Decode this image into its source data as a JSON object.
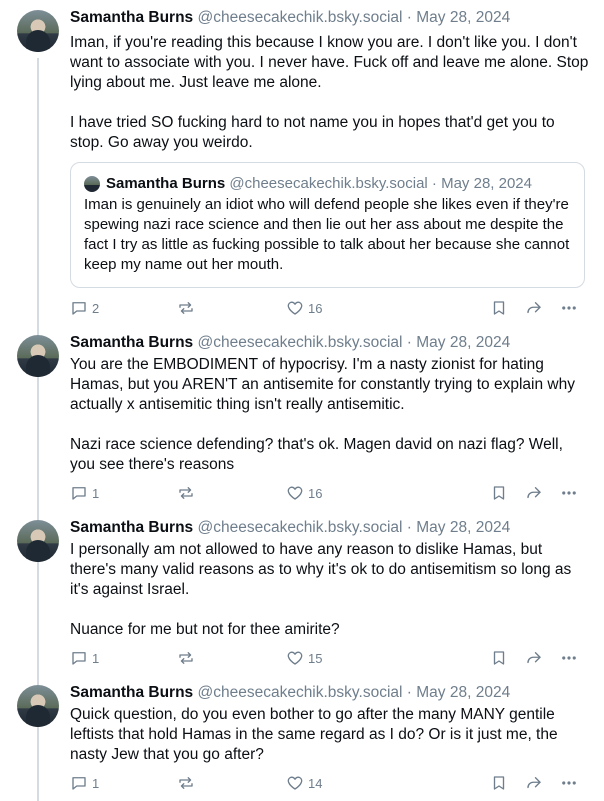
{
  "posts": [
    {
      "author": "Samantha Burns",
      "handle": "@cheesecakechik.bsky.social",
      "date": "May 28, 2024",
      "paragraphs": [
        "Iman, if you're reading this because I know you are. I don't like you. I don't want to associate with you. I never have. Fuck off and leave me alone. Stop lying about me. Just leave me alone.",
        "I have tried SO fucking hard to not name you in hopes that'd get you to stop. Go away you weirdo."
      ],
      "quote": {
        "author": "Samantha Burns",
        "handle": "@cheesecakechik.bsky.social",
        "date": "May 28, 2024",
        "text": "Iman is genuinely an idiot who will defend people she likes even if they're spewing nazi race science and then lie out her ass about me despite the fact I try as little as fucking possible to talk about her because she cannot keep my name out her mouth."
      },
      "replies": "2",
      "likes": "16"
    },
    {
      "author": "Samantha Burns",
      "handle": "@cheesecakechik.bsky.social",
      "date": "May 28, 2024",
      "paragraphs": [
        "You are the EMBODIMENT of hypocrisy. I'm a nasty zionist for hating Hamas, but you AREN'T an antisemite for constantly trying to explain why actually x antisemitic thing isn't really antisemitic.",
        "Nazi race science defending? that's ok. Magen david on nazi flag? Well, you see there's reasons"
      ],
      "replies": "1",
      "likes": "16"
    },
    {
      "author": "Samantha Burns",
      "handle": "@cheesecakechik.bsky.social",
      "date": "May 28, 2024",
      "paragraphs": [
        "I personally am not allowed to have any reason to dislike Hamas, but there's many valid reasons as to why it's ok to do antisemitism so long as it's against Israel.",
        "Nuance for me but not for thee amirite?"
      ],
      "replies": "1",
      "likes": "15"
    },
    {
      "author": "Samantha Burns",
      "handle": "@cheesecakechik.bsky.social",
      "date": "May 28, 2024",
      "paragraphs": [
        "Quick question, do you even bother to go after the many MANY gentile leftists that hold Hamas in the same regard as I do? Or is it just me, the nasty Jew that you go after?"
      ],
      "replies": "1",
      "likes": "14"
    }
  ],
  "separator": "·",
  "colors": {
    "text": "#0b0f14",
    "muted": "#6f7e8c",
    "border": "#d4dbe2"
  }
}
